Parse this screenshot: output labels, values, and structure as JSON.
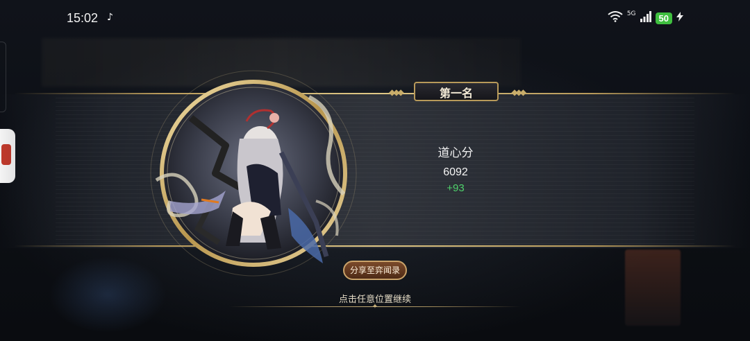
{
  "status_bar": {
    "time": "15:02",
    "network_label": "5G",
    "battery": "50"
  },
  "result": {
    "rank_title": "第一名",
    "score_label": "道心分",
    "score_value": "6092",
    "score_delta": "+93"
  },
  "actions": {
    "share_label": "分享至弈闻录",
    "continue_hint": "点击任意位置继续"
  },
  "colors": {
    "accent_gold": "#b89a5a",
    "delta_green": "#4fd26b",
    "battery_green": "#3fbf3f",
    "button_brown": "#6a3c20"
  },
  "icons": [
    "tiktok-icon",
    "wifi-icon",
    "signal-icon",
    "charging-icon"
  ]
}
